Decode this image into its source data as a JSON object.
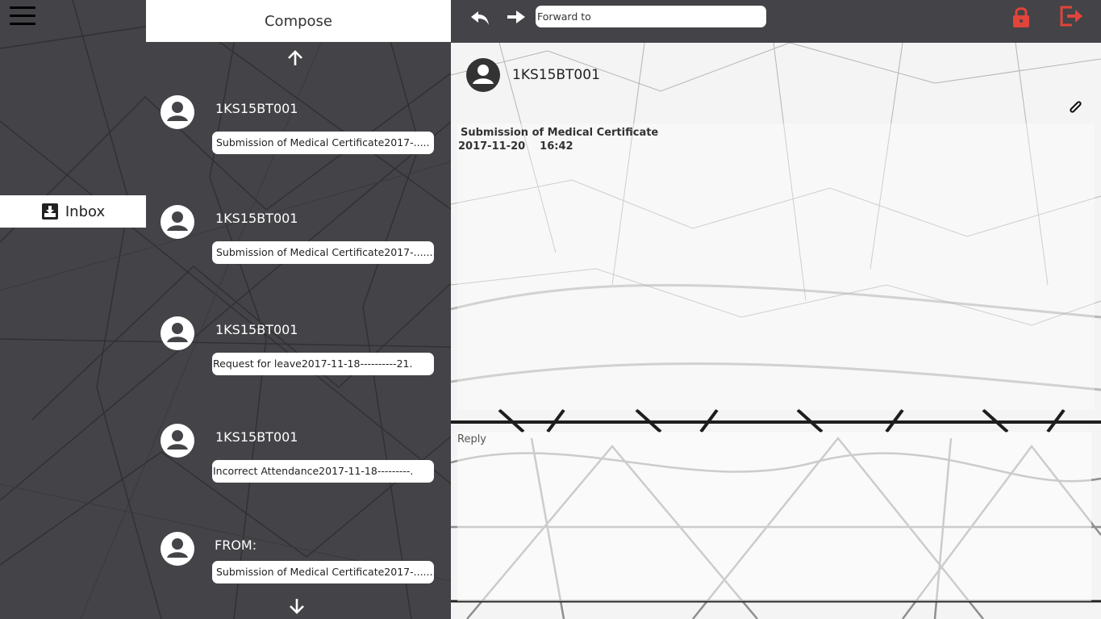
{
  "nav": {
    "inbox_label": "Inbox"
  },
  "list": {
    "compose_label": "Compose",
    "messages": [
      {
        "sender": "1KS15BT001",
        "preview": "Submission of Medical Certificate2017-....."
      },
      {
        "sender": "1KS15BT001",
        "preview": "Submission of Medical Certificate2017-........"
      },
      {
        "sender": "1KS15BT001",
        "preview": "Request for leave2017-11-18----------21."
      },
      {
        "sender": "1KS15BT001",
        "preview": "Incorrect Attendance2017-11-18---------."
      },
      {
        "sender": "FROM:",
        "preview": "Submission of Medical Certificate2017-......."
      }
    ]
  },
  "toolbar": {
    "forward_placeholder": "Forward to"
  },
  "reader": {
    "from": "1KS15BT001",
    "subject": "Submission of Medical Certificate",
    "date": "2017-11-20",
    "time": "16:42",
    "reply_placeholder": "Reply"
  },
  "colors": {
    "accent": "#e0443a",
    "panel": "#444347"
  },
  "icons": [
    "menu-icon",
    "inbox-icon",
    "arrow-up-icon",
    "arrow-down-icon",
    "avatar-icon",
    "reply-icon",
    "forward-icon",
    "lock-icon",
    "logout-icon",
    "paperclip-icon"
  ]
}
